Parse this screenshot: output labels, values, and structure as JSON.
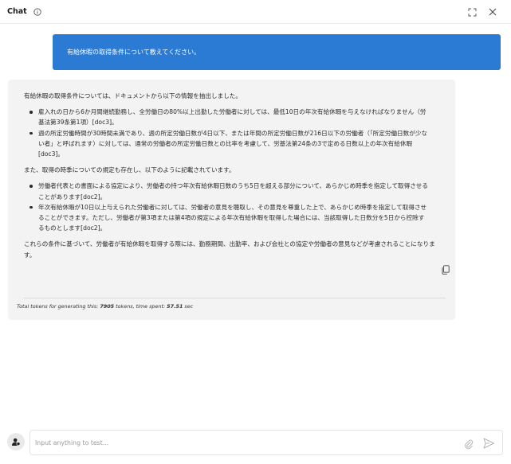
{
  "header": {
    "title": "Chat"
  },
  "conversation": {
    "user_message": "有給休暇の取得条件について教えてください。",
    "assistant": {
      "intro": "有給休暇の取得条件については、ドキュメントから以下の情報を抽出しました。",
      "bullets_1": [
        "雇入れの日から6か月間継続勤務し、全労働日の80%以上出勤した労働者に対しては、最低10日の年次有給休暇を与えなければなりません（労基法第39条第1項）[doc3]。",
        "週の所定労働時間が30時間未満であり、週の所定労働日数が4日以下、または年間の所定労働日数が216日以下の労働者（「所定労働日数が少ない者」と呼ばれます）に対しては、通常の労働者の所定労働日数との比率を考慮して、労基法第24条の3で定める日数以上の年次有給休暇[doc3]。"
      ],
      "middle": "また、取得の時季についての規定も存在し、以下のように記載されています。",
      "bullets_2": [
        "労働者代表との書面による協定により、労働者の持つ年次有給休暇日数のうち5日を超える部分について、あらかじめ時季を指定して取得させることがあります[doc2]。",
        "年次有給休暇が10日以上与えられた労働者に対しては、労働者の意見を聴取し、その意見を尊重した上で、あらかじめ時季を指定して取得させることができます。ただし、労働者が第3項または第4項の規定による年次有給休暇を取得した場合には、当該取得した日数分を5日から控除するものとします[doc2]。"
      ],
      "conclusion": "これらの条件に基づいて、労働者が有給休暇を取得する際には、勤務期間、出勤率、および会社との協定や労働者の意見などが考慮されることになります。",
      "token_prefix": "Total tokens for generating this: ",
      "token_count": "7905",
      "token_mid": " tokens, time spent: ",
      "time_spent": "57.51",
      "token_suffix": " sec"
    }
  },
  "input": {
    "placeholder": "Input anything to test..."
  },
  "icons": {
    "info": "info-icon",
    "expand": "expand-icon",
    "close": "close-icon",
    "copy": "copy-icon",
    "avatar": "assistant-avatar-icon",
    "attach": "paperclip-icon",
    "send": "send-icon"
  },
  "colors": {
    "user_bubble": "#2b7ad3",
    "assistant_card": "#f3f3f3"
  }
}
